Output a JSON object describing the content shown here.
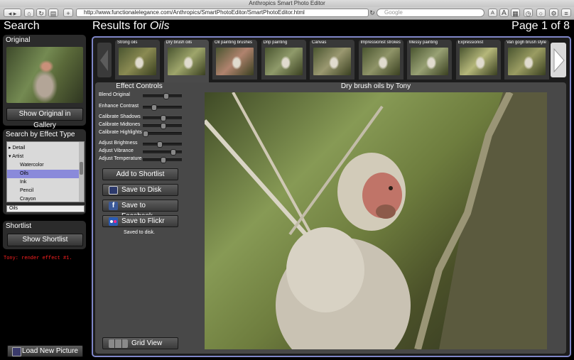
{
  "browser": {
    "window_title": "Anthropics Smart Photo Editor",
    "url": "http://www.functionalelegance.com/Anthropics/SmartPhotoEditor/SmartPhotoEditor.html",
    "search_placeholder": "Google",
    "font_small": "A",
    "font_large": "A"
  },
  "left": {
    "search_heading": "Search",
    "original_title": "Original",
    "show_original_label": "Show Original in Gallery",
    "effect_type_title": "Search by Effect Type",
    "tree": [
      {
        "label": "Detail",
        "indent": 0
      },
      {
        "label": "Artist",
        "indent": 0
      },
      {
        "label": "Watercolor",
        "indent": 1
      },
      {
        "label": "Oils",
        "indent": 1,
        "selected": true
      },
      {
        "label": "Ink",
        "indent": 1
      },
      {
        "label": "Pencil",
        "indent": 1
      },
      {
        "label": "Crayon",
        "indent": 1
      }
    ],
    "selected_effect": "Oils",
    "shortlist_title": "Shortlist",
    "show_shortlist_label": "Show Shortlist",
    "log_text": "Tony: render effect #1.",
    "load_picture_label": "Load New Picture"
  },
  "results": {
    "prefix": "Results for",
    "query": "Oils",
    "page": "Page 1 of 8"
  },
  "thumbs": [
    {
      "label": "Strong oils"
    },
    {
      "label": "Dry brush oils"
    },
    {
      "label": "Oil painting brushes"
    },
    {
      "label": "Drip painting"
    },
    {
      "label": "Canvas"
    },
    {
      "label": "Impressionist strokes"
    },
    {
      "label": "Messy painting"
    },
    {
      "label": "Expressionist"
    },
    {
      "label": "Van gogh brush style"
    }
  ],
  "effect": {
    "title": "Effect Controls",
    "sliders": [
      {
        "label": "Blend Original",
        "value": 0.6
      },
      {
        "label": "Enhance Contrast",
        "value": 0.25
      },
      {
        "label": "Calibrate Shadows",
        "value": 0.5
      },
      {
        "label": "Calibrate Midtones",
        "value": 0.5
      },
      {
        "label": "Calibrate Highlights",
        "value": 0.0
      },
      {
        "label": "Adjust Brightness",
        "value": 0.4
      },
      {
        "label": "Adjust Vibrance",
        "value": 0.8
      },
      {
        "label": "Adjust Temperature",
        "value": 0.5
      }
    ],
    "add_shortlist": "Add to Shortlist",
    "save_disk": "Save to Disk",
    "save_facebook": "Save to Facebook",
    "save_flickr": "Save to Flickr",
    "status": "Saved to disk.",
    "grid_view": "Grid View"
  },
  "preview": {
    "caption": "Dry brush oils by Tony"
  },
  "colors": {
    "accent_border": "#7f86c8",
    "selection": "#8a8ada",
    "log_red": "#ff2020"
  }
}
